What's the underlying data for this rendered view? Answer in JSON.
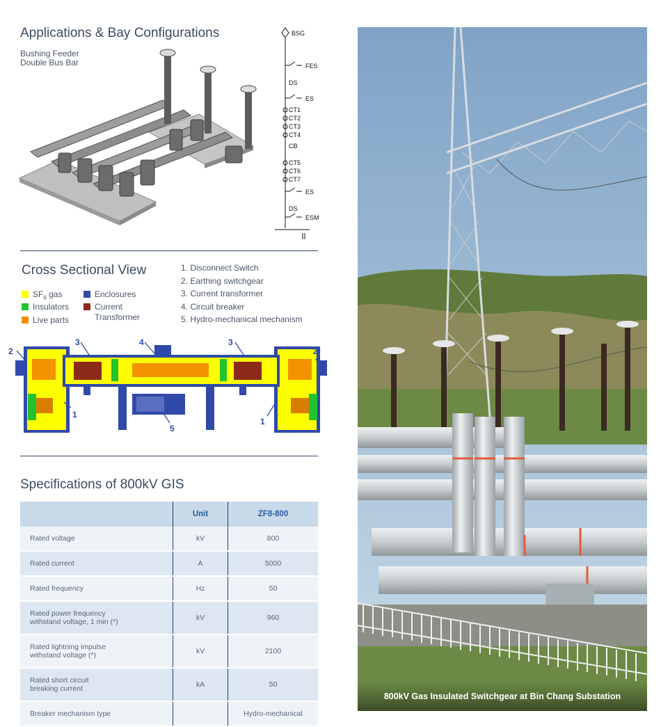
{
  "applications": {
    "title": "Applications & Bay Configurations",
    "subtitle_line1": "Bushing Feeder",
    "subtitle_line2": "Double Bus Bar"
  },
  "single_line": {
    "labels": [
      "BSG",
      "FES",
      "DS",
      "ES",
      "CT1",
      "CT2",
      "CT3",
      "CT4",
      "CB",
      "CT5",
      "CT6",
      "CT7",
      "ES",
      "DS",
      "ESM"
    ]
  },
  "cross_section": {
    "title": "Cross Sectional View",
    "legend": [
      {
        "label": "SF",
        "sub": "6",
        "suffix": " gas",
        "color": "#ffff00"
      },
      {
        "label": "Insulators",
        "color": "#22c32e"
      },
      {
        "label": "Live parts",
        "color": "#f39200"
      },
      {
        "label": "Enclosures",
        "color": "#2f4aa8"
      },
      {
        "label": "Current",
        "label2": "Transformer",
        "color": "#8a2a1a"
      }
    ],
    "parts": [
      "1. Disconnect Switch",
      "2. Earthing switchgear",
      "3. Current transformer",
      "4. Circuit breaker",
      "5. Hydro-mechanical mechanism"
    ],
    "callouts": [
      "2",
      "3",
      "4",
      "3",
      "2",
      "1",
      "5",
      "1"
    ]
  },
  "specs": {
    "title": "Specifications of 800kV GIS",
    "headers": [
      "",
      "Unit",
      "ZF8-800"
    ],
    "rows": [
      {
        "param": "Rated voltage",
        "param2": "",
        "unit": "kV",
        "value": "800"
      },
      {
        "param": "Rated current",
        "param2": "",
        "unit": "A",
        "value": "5000"
      },
      {
        "param": "Rated frequency",
        "param2": "",
        "unit": "Hz",
        "value": "50"
      },
      {
        "param": "Rated power frequency",
        "param2": "withstand voltage, 1 min (*)",
        "unit": "kV",
        "value": "960"
      },
      {
        "param": "Rated lightning impulse",
        "param2": "withstand voltage (*)",
        "unit": "kV",
        "value": "2100"
      },
      {
        "param": "Rated short circuit",
        "param2": "breaking current",
        "unit": "kA",
        "value": "50"
      },
      {
        "param": "Breaker mechanism type",
        "param2": "",
        "unit": "",
        "value": "Hydro-mechanical"
      }
    ]
  },
  "photo": {
    "caption": "800kV Gas Insulated Switchgear at Bin Chang Substation"
  }
}
